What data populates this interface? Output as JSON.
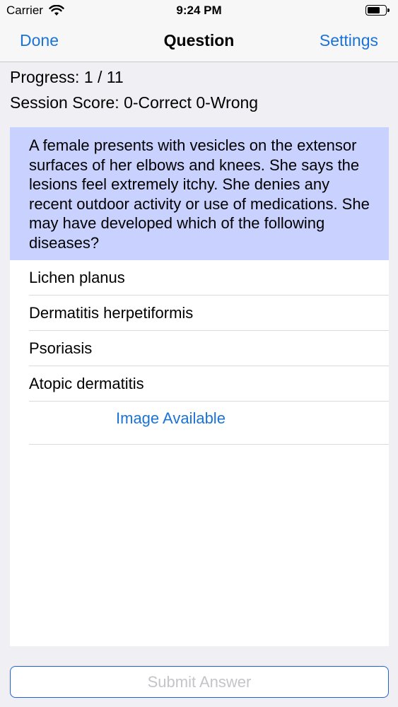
{
  "status_bar": {
    "carrier": "Carrier",
    "time": "9:24 PM",
    "icons": [
      "wifi-icon",
      "battery-icon"
    ]
  },
  "nav": {
    "left_label": "Done",
    "title": "Question",
    "right_label": "Settings"
  },
  "info": {
    "progress": "Progress: 1 / 11",
    "score": "Session Score: 0-Correct 0-Wrong"
  },
  "question": {
    "text": "A female presents with vesicles on the extensor surfaces of her elbows and knees. She says the lesions feel extremely itchy. She denies any recent outdoor activity or use of medications. She may have developed which of the following diseases?"
  },
  "answers": [
    {
      "label": "Lichen planus"
    },
    {
      "label": "Dermatitis herpetiformis"
    },
    {
      "label": "Psoriasis"
    },
    {
      "label": "Atopic dermatitis"
    }
  ],
  "image_link": "Image Available",
  "submit_label": "Submit Answer",
  "colors": {
    "accent": "#1a73d6",
    "question_bg": "#c9d2ff",
    "page_bg": "#efeff4",
    "disabled_text": "#c4c4c9"
  }
}
